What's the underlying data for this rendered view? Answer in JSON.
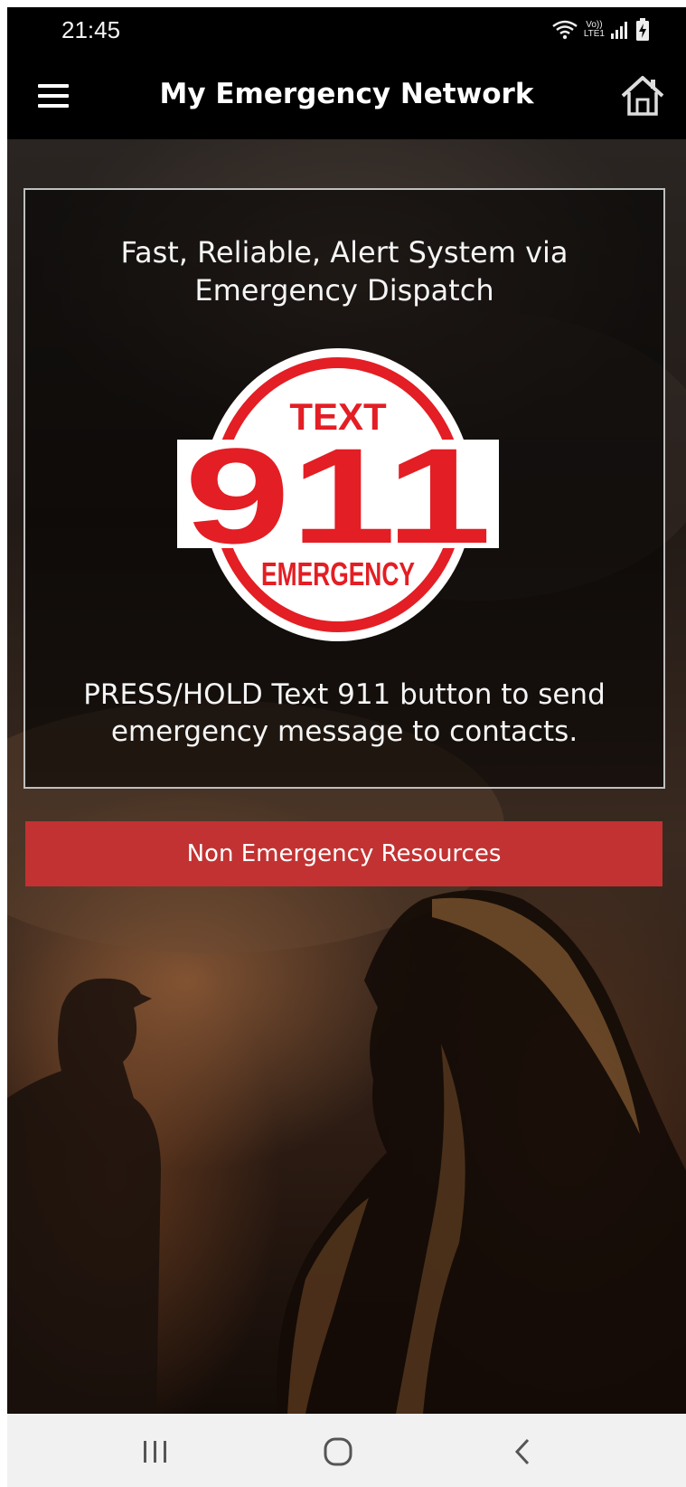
{
  "status_bar": {
    "time": "21:45",
    "network_label_top": "Vo))",
    "network_label_bottom": "LTE1",
    "icons": [
      "wifi-icon",
      "signal-icon",
      "battery-charging-icon"
    ]
  },
  "app_bar": {
    "title": "My Emergency Network",
    "menu_icon": "hamburger-menu-icon",
    "home_icon": "home-icon"
  },
  "card": {
    "tagline": "Fast, Reliable, Alert System via Emergency Dispatch",
    "logo": {
      "top_text": "TEXT",
      "number": "911",
      "bottom_text": "EMERGENCY"
    },
    "instruction": "PRESS/HOLD Text 911 button to send emergency message to contacts."
  },
  "non_emergency_button": {
    "label": "Non Emergency Resources"
  },
  "colors": {
    "accent_red": "#c23232",
    "logo_red": "#e31e24",
    "bar_black": "#000000"
  },
  "nav_bar": {
    "icons": [
      "recent-apps-icon",
      "home-circle-icon",
      "back-chevron-icon"
    ]
  }
}
